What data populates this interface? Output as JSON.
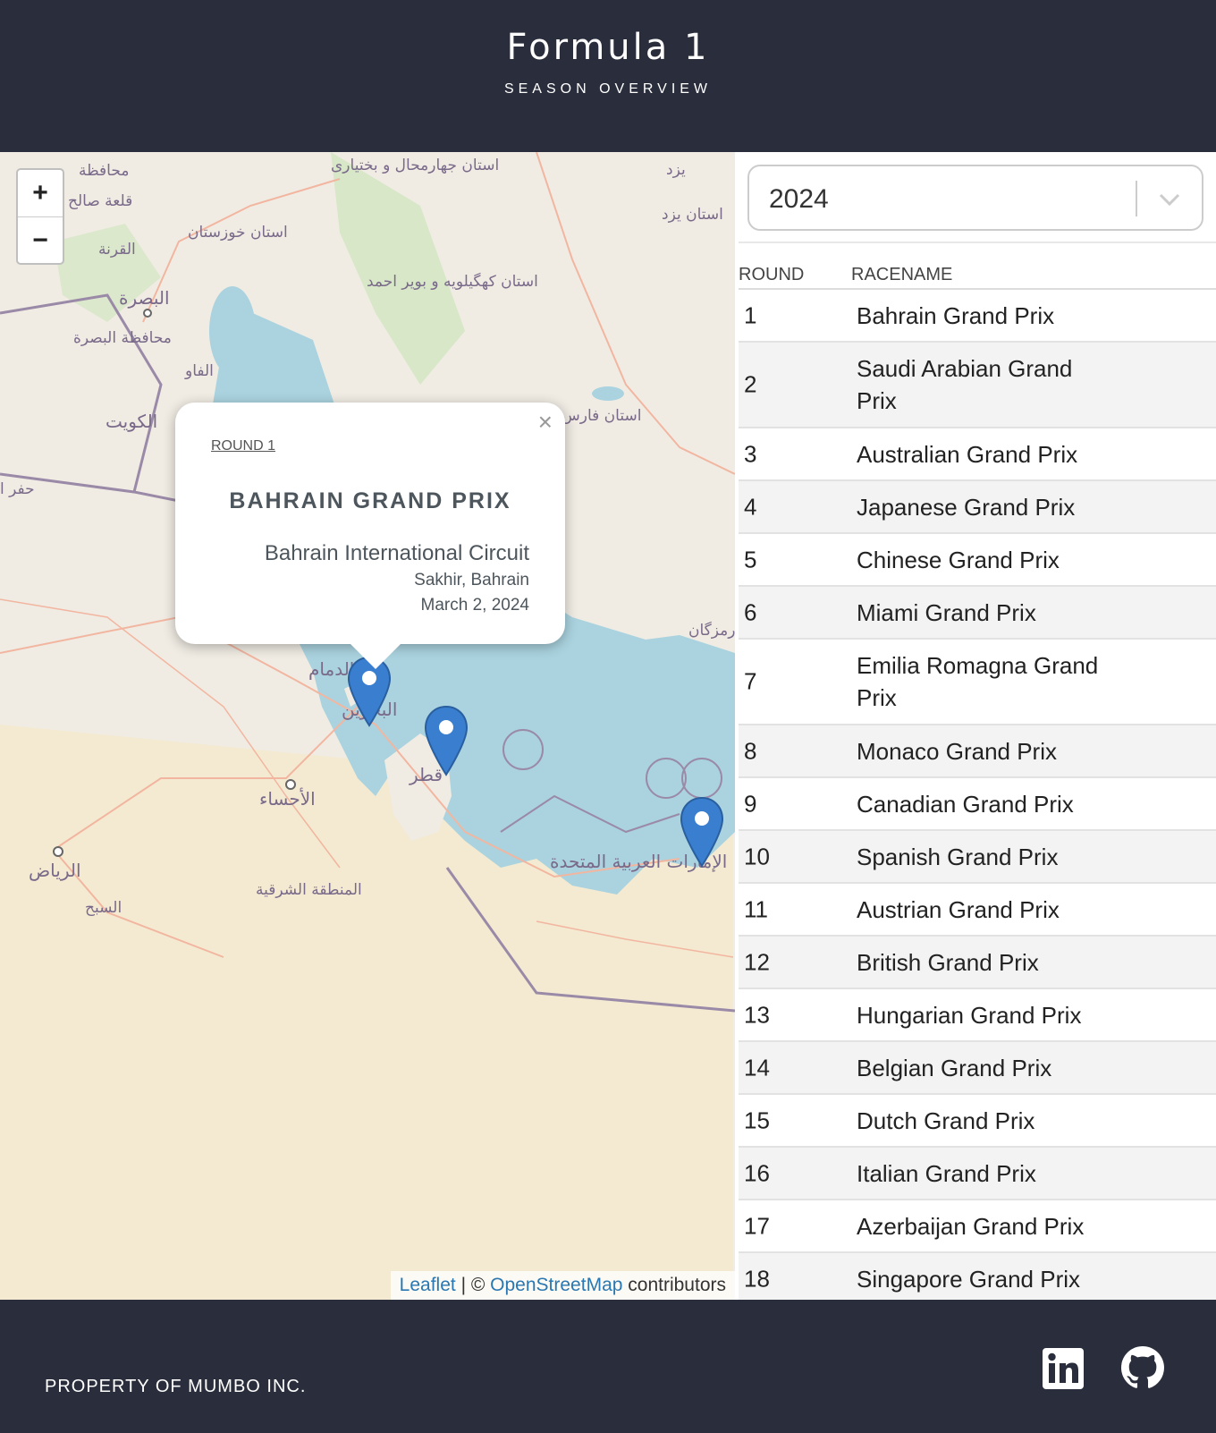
{
  "header": {
    "title": "Formula 1",
    "subtitle": "SEASON OVERVIEW"
  },
  "map": {
    "zoom_in": "+",
    "zoom_out": "−",
    "attribution": {
      "leaflet": "Leaflet",
      "separator": " | © ",
      "osm": "OpenStreetMap",
      "suffix": " contributors"
    },
    "popup": {
      "round": "ROUND 1",
      "race": "BAHRAIN GRAND PRIX",
      "circuit": "Bahrain International Circuit",
      "location": "Sakhir, Bahrain",
      "date": "March 2, 2024",
      "close": "×"
    },
    "labels": [
      "استان جهارمحال و بختیاری",
      "یزد",
      "استان یزد",
      "استان خوزستان",
      "استان کهگیلویه و بویر احمد",
      "البصرة",
      "محافظة البصرة",
      "الكويت",
      "حفر ا",
      "الفاو",
      "القرنة",
      "قلعة صالح",
      "محافظة",
      "استان فارس",
      "رمزگان",
      "الدمام",
      "البحرين",
      "قطر",
      "الأحساء",
      "الرياض",
      "السبح",
      "المنطقة الشرقية",
      "الإمارات العربية المتحدة"
    ]
  },
  "sidebar": {
    "season": "2024",
    "columns": [
      "ROUND",
      "RACENAME"
    ],
    "races": [
      {
        "round": "1",
        "name": "Bahrain Grand Prix"
      },
      {
        "round": "2",
        "name": "Saudi Arabian Grand Prix"
      },
      {
        "round": "3",
        "name": "Australian Grand Prix"
      },
      {
        "round": "4",
        "name": "Japanese Grand Prix"
      },
      {
        "round": "5",
        "name": "Chinese Grand Prix"
      },
      {
        "round": "6",
        "name": "Miami Grand Prix"
      },
      {
        "round": "7",
        "name": "Emilia Romagna Grand Prix"
      },
      {
        "round": "8",
        "name": "Monaco Grand Prix"
      },
      {
        "round": "9",
        "name": "Canadian Grand Prix"
      },
      {
        "round": "10",
        "name": "Spanish Grand Prix"
      },
      {
        "round": "11",
        "name": "Austrian Grand Prix"
      },
      {
        "round": "12",
        "name": "British Grand Prix"
      },
      {
        "round": "13",
        "name": "Hungarian Grand Prix"
      },
      {
        "round": "14",
        "name": "Belgian Grand Prix"
      },
      {
        "round": "15",
        "name": "Dutch Grand Prix"
      },
      {
        "round": "16",
        "name": "Italian Grand Prix"
      },
      {
        "round": "17",
        "name": "Azerbaijan Grand Prix"
      },
      {
        "round": "18",
        "name": "Singapore Grand Prix"
      }
    ]
  },
  "footer": {
    "property": "PROPERTY OF MUMBO INC.",
    "icons": [
      "linkedin-icon",
      "github-icon"
    ]
  },
  "colors": {
    "header_bg": "#2a2d3b",
    "water": "#aad3df",
    "land": "#f0ece4",
    "desert": "#f4ead1",
    "marker": "#3a7fcf",
    "link": "#2a77b1"
  }
}
